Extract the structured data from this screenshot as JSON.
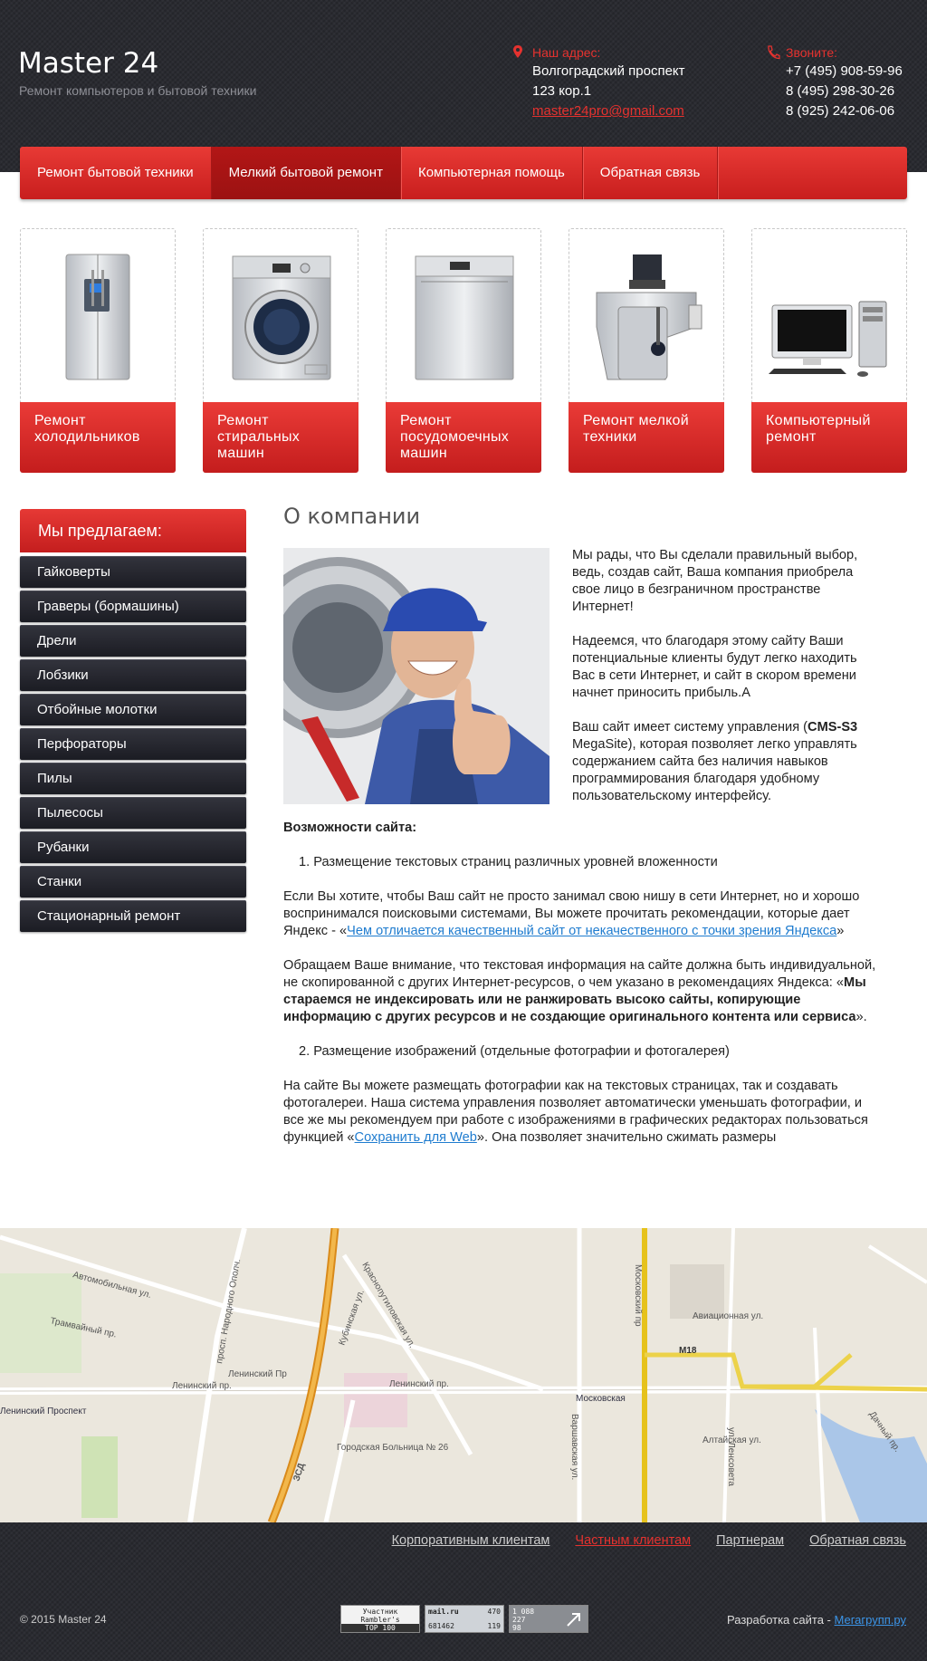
{
  "header": {
    "site_title": "Master 24",
    "site_subtitle": "Ремонт компьютеров и бытовой техники",
    "address_label": "Наш адрес:",
    "address_line1": "Волгоградский проспект",
    "address_line2": "123 кор.1",
    "email": "master24pro@gmail.com",
    "phone_label": "Звоните:",
    "phone1": "+7 (495) 908-59-96",
    "phone2": "8 (495) 298-30-26",
    "phone3": "8 (925) 242-06-06"
  },
  "nav": {
    "items": [
      {
        "label": "Ремонт бытовой техники"
      },
      {
        "label": "Мелкий бытовой ремонт"
      },
      {
        "label": "Компьютерная помощь"
      },
      {
        "label": "Обратная связь"
      }
    ],
    "active_index": 1
  },
  "categories": [
    {
      "label": "Ремонт холодильников",
      "icon": "fridge-icon"
    },
    {
      "label": "Ремонт стиральных машин",
      "icon": "washing-machine-icon"
    },
    {
      "label": "Ремонт посудомоечных машин",
      "icon": "dishwasher-icon"
    },
    {
      "label": "Ремонт мелкой техники",
      "icon": "juicer-icon"
    },
    {
      "label": "Компьютерный ремонт",
      "icon": "computer-icon"
    }
  ],
  "sidebar": {
    "heading": "Мы предлагаем:",
    "items": [
      {
        "label": "Гайковерты"
      },
      {
        "label": "Граверы (бормашины)"
      },
      {
        "label": "Дрели"
      },
      {
        "label": "Лобзики"
      },
      {
        "label": "Отбойные молотки"
      },
      {
        "label": "Перфораторы"
      },
      {
        "label": "Пилы"
      },
      {
        "label": "Пылесосы"
      },
      {
        "label": "Рубанки"
      },
      {
        "label": "Станки"
      },
      {
        "label": "Стационарный ремонт"
      }
    ]
  },
  "main": {
    "title": "О компании",
    "intro_p1": "Мы рады, что Вы сделали правильный выбор, ведь, создав сайт, Ваша компания приобрела свое лицо в безграничном пространстве Интернет!",
    "intro_p2": "Надеемся, что благодаря этому сайту Ваши потенциальные клиенты будут легко находить Вас в сети Интернет, и сайт в скором времени начнет приносить прибыль.А",
    "intro_p3_before": "Ваш сайт имеет систему управления (",
    "intro_p3_bold": "CMS-S3",
    "intro_p3_after": " MegaSite), которая позволяет легко управлять содержанием сайта без наличия навыков программирования благодаря удобному пользовательскому интерфейсу.",
    "features_heading": "Возможности сайта:",
    "item1": "1. Размещение текстовых страниц различных уровней вложенности",
    "para1_before": "Если Вы хотите, чтобы Ваш сайт не просто занимал свою нишу в сети Интернет, но и хорошо воспринимался поисковыми системами, Вы можете прочитать рекомендации, которые дает Яндекс - «",
    "para1_link": "Чем отличается качественный сайт от некачественного с точки зрения Яндекса",
    "para1_after": "»",
    "para2_before": "Обращаем Ваше внимание, что текстовая информация на сайте должна быть индивидуальной, не скопированной с других Интернет-ресурсов, о чем указано в рекомендациях Яндекса: «",
    "para2_bold": "Мы стараемся не индексировать или не ранжировать высоко сайты, копирующие информацию с других ресурсов и не создающие оригинального контента или сервиса",
    "para2_after": "».",
    "item2": "2. Размещение изображений (отдельные фотографии и фотогалерея)",
    "para3_before": "На сайте Вы можете размещать фотографии как на текстовых страницах, так и создавать фотогалереи. Наша система управления позволяет автоматически уменьшать фотографии, и все же мы рекомендуем при работе с изображениями в графических редакторах пользоваться функцией «",
    "para3_link": "Сохранить для Web",
    "para3_after": "». Она позволяет значительно сжимать размеры"
  },
  "map": {
    "labels": {
      "road1": "Автомобильная ул.",
      "road2": "Трамвайный пр.",
      "road3": "просп. Народного Ополч.",
      "road4": "Ленинский Пр",
      "road5": "Ленинский пр.",
      "road6": "Ленинский пр.",
      "metro1": "Ленинский Проспект",
      "metro2": "Московская",
      "road7": "Кубинская ул.",
      "road8": "Краснопутиловская ул.",
      "road9": "Московский пр",
      "road10": "Авиационная ул.",
      "road11": "Алтайская ул.",
      "road12": "Варшавская ул.",
      "road13": "ул. Ленсовета",
      "road14": "Дачный пр.",
      "hospital": "Городская Больница № 26",
      "zsd": "ЗСД",
      "m18": "М18"
    }
  },
  "footer": {
    "links": [
      {
        "label": "Корпоративным клиентам"
      },
      {
        "label": "Частным клиентам"
      },
      {
        "label": "Партнерам"
      },
      {
        "label": "Обратная связь"
      }
    ],
    "active_index": 1,
    "copyright": "© 2015 Master 24",
    "dev_label": "Разработка сайта - ",
    "dev_link": "Мегагрупп.ру",
    "counter1_l1": "Участник",
    "counter1_l2": "Rambler's",
    "counter1_l3": "TOP 100",
    "counter2_l1": "mail.ru",
    "counter2_a": "470",
    "counter2_b": "681462",
    "counter2_c": "119",
    "counter3_a": "1 088",
    "counter3_b": "227",
    "counter3_c": "98"
  },
  "colors": {
    "accent": "#e5322f",
    "dark": "#2a2b31",
    "link": "#1f7ccf"
  }
}
